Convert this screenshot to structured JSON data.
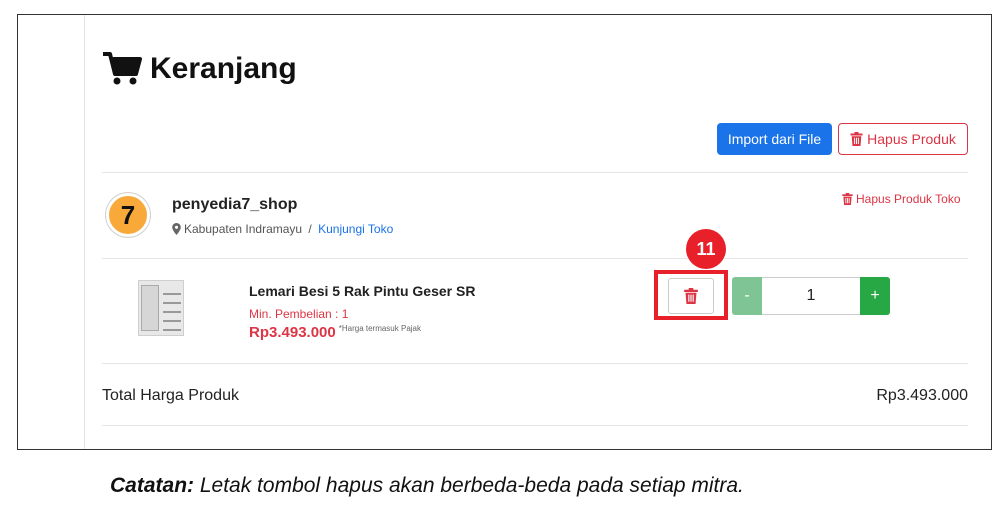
{
  "page": {
    "title": "Keranjang"
  },
  "toolbar": {
    "import_label": "Import dari File",
    "hapus_produk_label": "Hapus Produk"
  },
  "shop": {
    "avatar_text": "7",
    "name": "penyedia7_shop",
    "location": "Kabupaten Indramayu",
    "separator": " / ",
    "visit_link": "Kunjungi Toko",
    "hapus_toko_label": "Hapus Produk Toko"
  },
  "product": {
    "name": "Lemari Besi 5 Rak Pintu Geser SR",
    "min_purchase": "Min. Pembelian : 1",
    "price": "Rp3.493.000",
    "tax_note": "*Harga termasuk Pajak",
    "quantity": "1",
    "minus_label": "-",
    "plus_label": "+"
  },
  "annotation": {
    "badge": "11"
  },
  "total": {
    "label": "Total Harga Produk",
    "value": "Rp3.493.000"
  },
  "note": {
    "bold": "Catatan:",
    "text": " Letak tombol hapus akan berbeda-beda pada setiap mitra."
  },
  "colors": {
    "primary": "#1a73e8",
    "danger": "#dc3545",
    "success": "#28a745",
    "highlight": "#e8202a",
    "avatar": "#f9a93a"
  },
  "icons": {
    "cart": "shopping-cart-icon",
    "trash": "trash-icon",
    "location": "map-marker-icon"
  }
}
